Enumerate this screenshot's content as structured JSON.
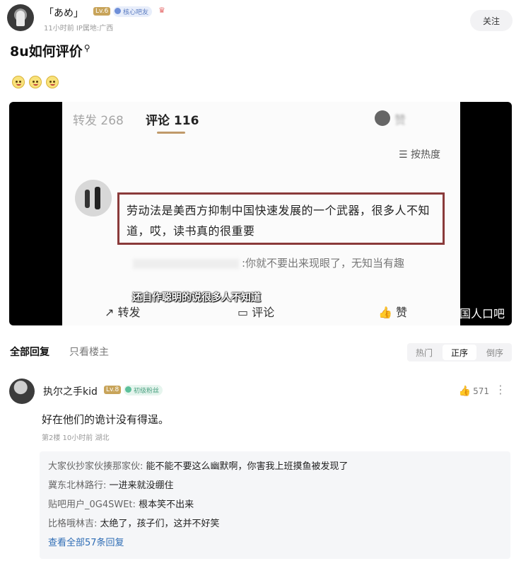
{
  "post": {
    "author": "「あめ」",
    "level": "Lv.6",
    "core_badge": "核心吧友",
    "meta": "11小时前   IP属地:广西",
    "follow_label": "关注",
    "title": "8u如何评价"
  },
  "video": {
    "tab_forward": "转发 268",
    "tab_comment": "评论 116",
    "sort_label": "按热度",
    "highlight_comment": "劳动法是美西方抑制中国快速发展的一个武器，很多人不知道，哎，读书真的很重要",
    "reply_text": ":你就不要出来现眼了，无知当有趣",
    "subtitle": "还自作聪明的说很多人不知道",
    "action_forward": "转发",
    "action_comment": "评论",
    "action_like": "赞",
    "watermark": "国人口吧"
  },
  "replies_bar": {
    "all_label": "全部回复",
    "op_only_label": "只看楼主",
    "sort_tabs": [
      "热门",
      "正序",
      "倒序"
    ],
    "active_sort": "正序"
  },
  "floor": {
    "author": "执尔之手kid",
    "level": "Lv.8",
    "badge": "初级粉丝",
    "likes": "571",
    "text": "好在他们的诡计没有得逞。",
    "meta": "第2楼  10小时前  湖北",
    "sub_replies": [
      {
        "who": "大家伙抄家伙揍那家伙:",
        "text": "能不能不要这么幽默啊，你害我上班摸鱼被发现了"
      },
      {
        "who": "冀东北林路行:",
        "text": "一进来就没绷住"
      },
      {
        "who": "贴吧用户_0G4SWEt:",
        "text": "根本笑不出来"
      },
      {
        "who": "比格哦林吉:",
        "text": "太绝了，孩子们，这并不好笑"
      }
    ],
    "view_all": "查看全部57条回复"
  }
}
